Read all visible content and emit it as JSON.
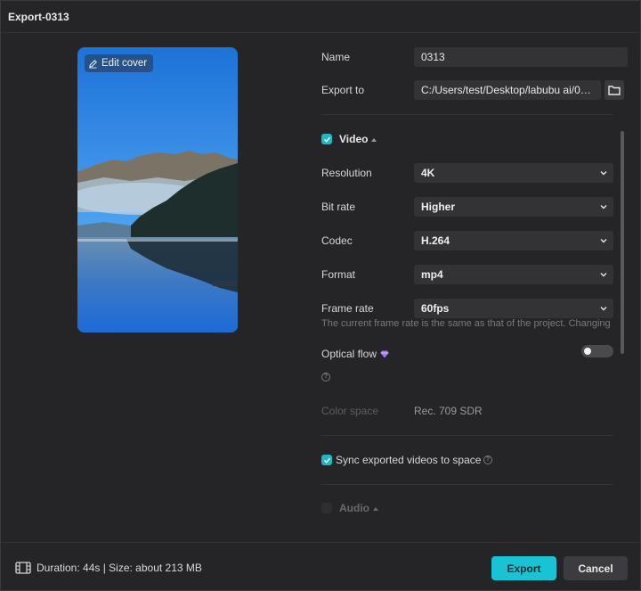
{
  "window": {
    "title": "Export-0313"
  },
  "cover": {
    "edit_label": "Edit cover"
  },
  "fields": {
    "name": {
      "label": "Name",
      "value": "0313"
    },
    "export_to": {
      "label": "Export to",
      "value": "C:/Users/test/Desktop/labubu ai/0313"
    }
  },
  "video": {
    "enabled": true,
    "title": "Video",
    "resolution": {
      "label": "Resolution",
      "value": "4K"
    },
    "bit_rate": {
      "label": "Bit rate",
      "value": "Higher"
    },
    "codec": {
      "label": "Codec",
      "value": "H.264"
    },
    "format": {
      "label": "Format",
      "value": "mp4"
    },
    "frame_rate": {
      "label": "Frame rate",
      "value": "60fps"
    },
    "frame_rate_note": "The current frame rate is the same as that of the project. Changing",
    "optical_flow": {
      "label": "Optical flow",
      "enabled": false
    },
    "color_space": {
      "label": "Color space",
      "value": "Rec. 709 SDR"
    }
  },
  "sync": {
    "checked": true,
    "label": "Sync exported videos to space"
  },
  "audio": {
    "enabled": false,
    "title": "Audio"
  },
  "footer": {
    "info": "Duration: 44s | Size: about 213 MB",
    "export_label": "Export",
    "cancel_label": "Cancel"
  },
  "colors": {
    "accent": "#19c3d3",
    "background": "#252527",
    "field": "#333336"
  }
}
